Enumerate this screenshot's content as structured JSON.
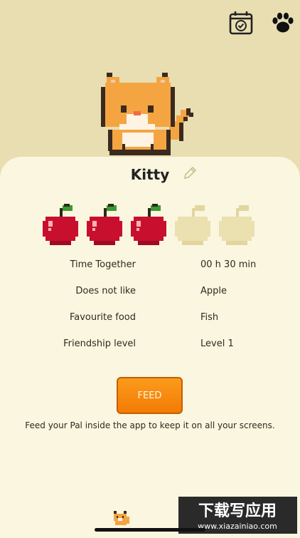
{
  "header": {
    "calendar_icon": "calendar-check-icon",
    "paw_icon": "paw-icon"
  },
  "pet": {
    "name": "Kitty",
    "apples_full": 3,
    "apples_total": 5
  },
  "stats": [
    {
      "label": "Time Together",
      "value": "00 h 30 min"
    },
    {
      "label": "Does not like",
      "value": "Apple"
    },
    {
      "label": "Favourite food",
      "value": "Fish"
    },
    {
      "label": "Friendship level",
      "value": "Level 1"
    }
  ],
  "feed_button": "FEED",
  "hint": "Feed your Pal inside the app to keep it on all your screens.",
  "watermark": {
    "line1": "下载写应用",
    "line2": "www.xiazainiao.com"
  },
  "colors": {
    "background": "#e8deb2",
    "card": "#fbf6df",
    "accent": "#f37b05",
    "apple_full": "#c8102e",
    "apple_empty": "#e9dfae"
  }
}
